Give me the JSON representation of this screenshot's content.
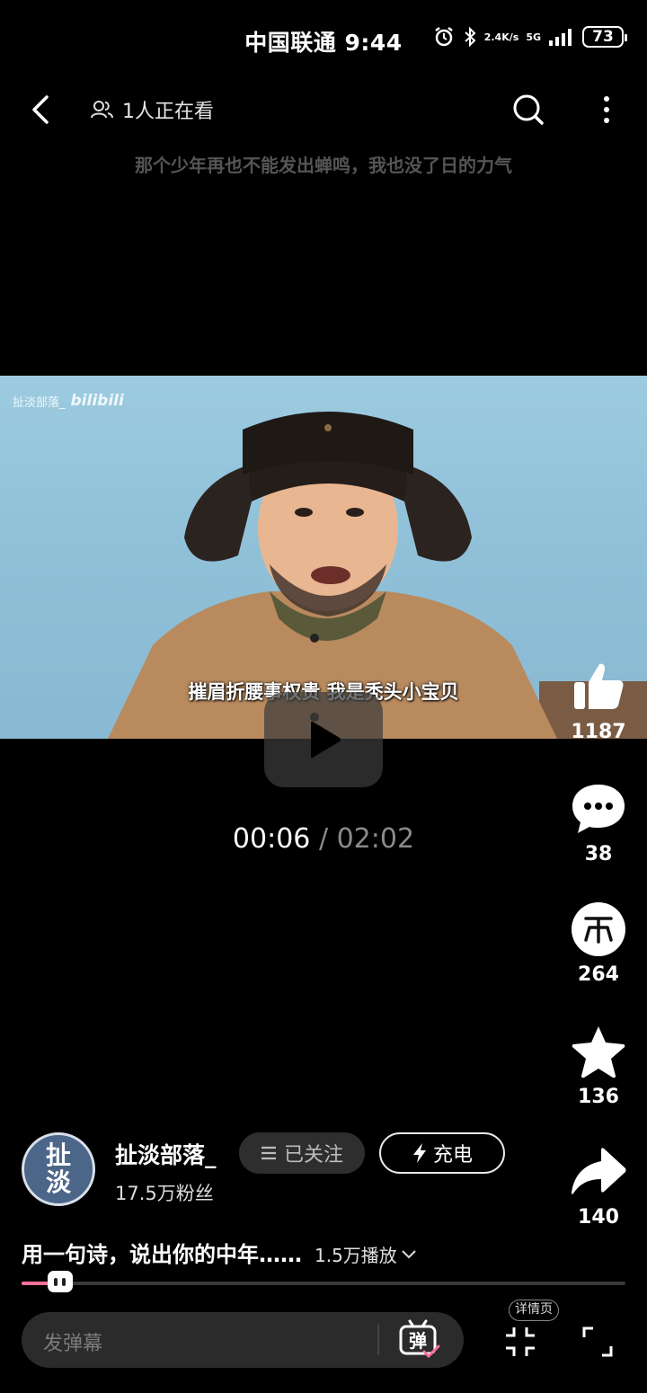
{
  "status_bar": {
    "carrier_time": "中国联通 9:44",
    "net_speed_value": "2.4",
    "net_speed_unit": "K/s",
    "network": "5G",
    "battery": "73"
  },
  "top_bar": {
    "viewers": "1人正在看"
  },
  "danmaku_comment": "那个少年再也不能发出蝉鸣，我也没了日的力气",
  "video": {
    "watermark_author": "扯淡部落_",
    "watermark_logo": "bilibili",
    "subtitle": "摧眉折腰事权贵  我是秃头小宝贝",
    "current_time": "00:06",
    "separator": "/",
    "total_time": "02:02",
    "progress_fraction": 0.049
  },
  "actions": {
    "like_count": "1187",
    "comment_count": "38",
    "coin_count": "264",
    "favorite_count": "136",
    "share_count": "140"
  },
  "author": {
    "avatar_text": "扯\n淡",
    "name": "扯淡部落_",
    "fans": "17.5万粉丝",
    "follow_label": "已关注",
    "charge_label": "充电"
  },
  "video_info": {
    "title": "用一句诗，说出你的中年……",
    "play_count": "1.5万播放"
  },
  "bottom_bar": {
    "danmaku_placeholder": "发弹幕",
    "danmaku_toggle_label": "弹",
    "detail_tag": "详情页"
  },
  "colors": {
    "accent": "#fb7299",
    "background": "#000000"
  }
}
